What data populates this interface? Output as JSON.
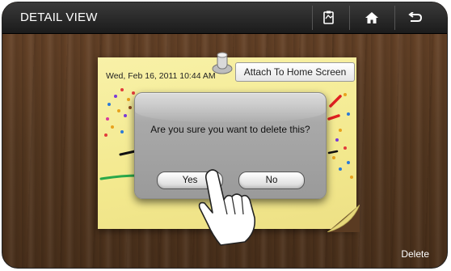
{
  "header": {
    "title": "DETAIL VIEW",
    "buttons": [
      {
        "icon": "memo-icon"
      },
      {
        "icon": "home-icon"
      },
      {
        "icon": "back-icon"
      }
    ]
  },
  "note": {
    "date": "Wed, Feb 16, 2011 10:44 AM",
    "attach_label": "Attach To Home Screen",
    "background_color": "#f5eda0"
  },
  "dialog": {
    "message": "Are you sure you want to delete this?",
    "yes_label": "Yes",
    "no_label": "No"
  },
  "footer": {
    "delete_label": "Delete"
  },
  "colors": {
    "titlebar": "#262626",
    "wood": "#5b3c25",
    "dialog": "#a5a5a5"
  }
}
